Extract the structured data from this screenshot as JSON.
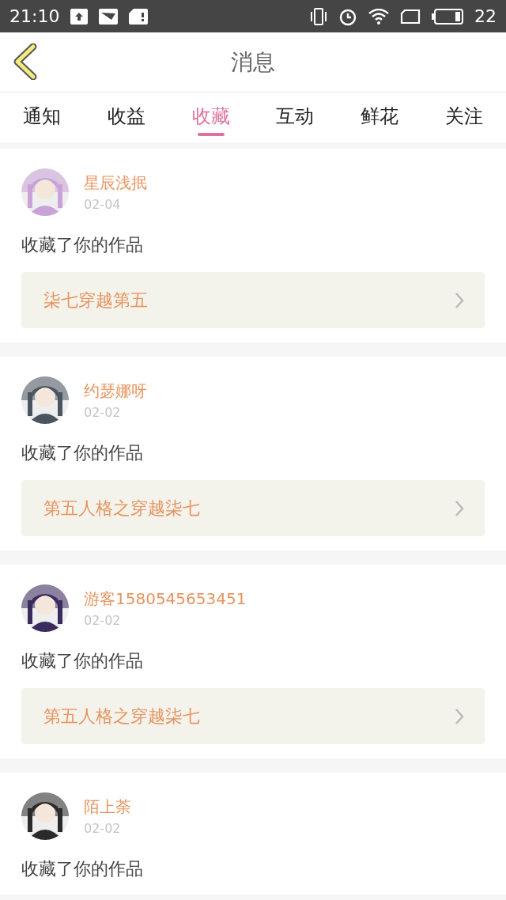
{
  "status_bar": {
    "time": "21:10",
    "battery": "22"
  },
  "header": {
    "title": "消息"
  },
  "tabs": [
    {
      "label": "通知",
      "selected": false
    },
    {
      "label": "收益",
      "selected": false
    },
    {
      "label": "收藏",
      "selected": true
    },
    {
      "label": "互动",
      "selected": false
    },
    {
      "label": "鲜花",
      "selected": false
    },
    {
      "label": "关注",
      "selected": false
    }
  ],
  "messages": [
    {
      "user": "星辰浅抿",
      "date": "02-04",
      "text": "收藏了你的作品",
      "work": "柒七穿越第五"
    },
    {
      "user": "约瑟娜呀",
      "date": "02-02",
      "text": "收藏了你的作品",
      "work": "第五人格之穿越柒七"
    },
    {
      "user": "游客1580545653451",
      "date": "02-02",
      "text": "收藏了你的作品",
      "work": "第五人格之穿越柒七"
    },
    {
      "user": "陌上荼",
      "date": "02-02",
      "text": "收藏了你的作品"
    }
  ]
}
